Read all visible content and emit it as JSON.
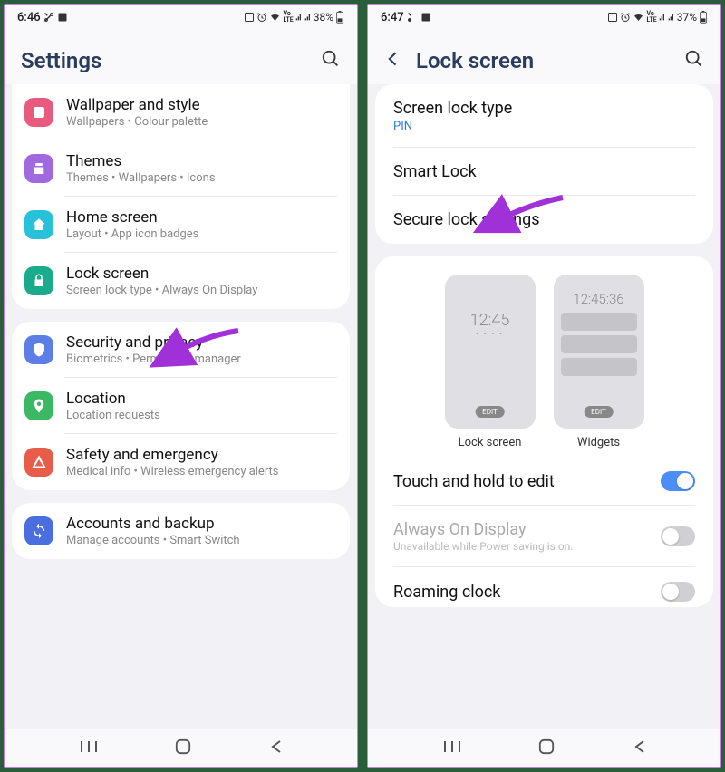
{
  "left": {
    "status": {
      "time": "6:46",
      "battery": "38%"
    },
    "header": {
      "title": "Settings"
    },
    "groups": [
      {
        "items": [
          {
            "title": "Wallpaper and style",
            "sub": "Wallpapers  •  Colour palette",
            "icon": "wallpaper",
            "color": "#e85a7e"
          },
          {
            "title": "Themes",
            "sub": "Themes  •  Wallpapers  •  Icons",
            "icon": "themes",
            "color": "#a069e0"
          },
          {
            "title": "Home screen",
            "sub": "Layout  •  App icon badges",
            "icon": "home",
            "color": "#29c0d9"
          },
          {
            "title": "Lock screen",
            "sub": "Screen lock type  •  Always On Display",
            "icon": "lock",
            "color": "#1aab8c"
          }
        ]
      },
      {
        "items": [
          {
            "title": "Security and privacy",
            "sub": "Biometrics  •  Permission manager",
            "icon": "shield",
            "color": "#5d7ee6"
          },
          {
            "title": "Location",
            "sub": "Location requests",
            "icon": "location",
            "color": "#3bb864"
          },
          {
            "title": "Safety and emergency",
            "sub": "Medical info  •  Wireless emergency alerts",
            "icon": "safety",
            "color": "#e85c4a"
          }
        ]
      },
      {
        "items": [
          {
            "title": "Accounts and backup",
            "sub": "Manage accounts  •  Smart Switch",
            "icon": "sync",
            "color": "#4a6ee0"
          }
        ]
      }
    ]
  },
  "right": {
    "status": {
      "time": "6:47",
      "battery": "37%"
    },
    "header": {
      "title": "Lock screen"
    },
    "card1": [
      {
        "title": "Screen lock type",
        "sub": "PIN"
      },
      {
        "title": "Smart Lock"
      },
      {
        "title": "Secure lock settings"
      }
    ],
    "previews": {
      "lock": {
        "clock": "12:45",
        "edit": "EDIT",
        "label": "Lock screen"
      },
      "widgets": {
        "clock": "12:45:36",
        "edit": "EDIT",
        "label": "Widgets"
      }
    },
    "toggles": [
      {
        "title": "Touch and hold to edit",
        "on": true
      },
      {
        "title": "Always On Display",
        "sub": "Unavailable while Power saving is on.",
        "disabled": true,
        "on": false
      },
      {
        "title": "Roaming clock",
        "on": false
      }
    ]
  },
  "statusIcons": {
    "lte": "Vo\nLTE"
  }
}
